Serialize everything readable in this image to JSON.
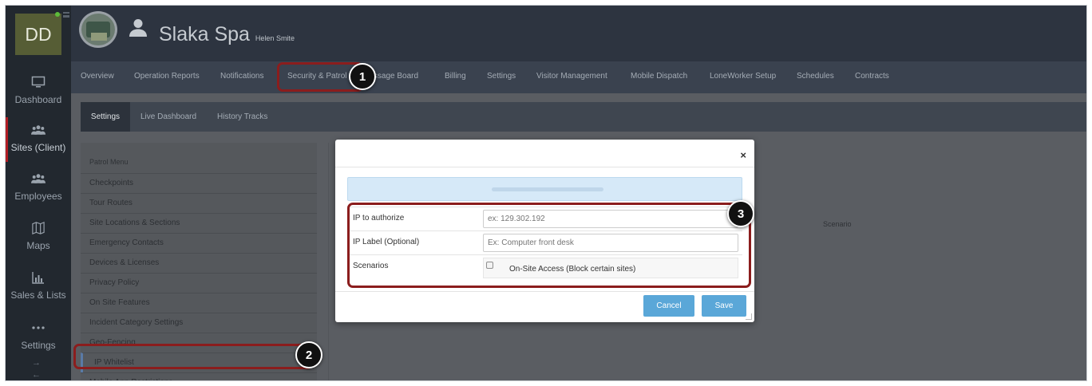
{
  "brand": {
    "initials": "DD"
  },
  "header": {
    "company": "Slaka Spa",
    "user": "Helen Smite"
  },
  "rail": {
    "items": [
      {
        "label": "Dashboard",
        "icon": "monitor-icon"
      },
      {
        "label": "Sites (Client)",
        "icon": "users-group-icon"
      },
      {
        "label": "Employees",
        "icon": "users-group-icon"
      },
      {
        "label": "Maps",
        "icon": "map-icon"
      },
      {
        "label": "Sales & Lists",
        "icon": "bar-chart-icon"
      },
      {
        "label": "Settings",
        "icon": "dots-icon"
      }
    ],
    "arrows": [
      "→",
      "←"
    ]
  },
  "nav": {
    "tabs": [
      "Overview",
      "Operation Reports",
      "Notifications",
      "Security & Patrol",
      "Message Board",
      "Billing",
      "Settings",
      "Visitor Management",
      "Mobile Dispatch",
      "LoneWorker Setup",
      "Schedules",
      "Contracts"
    ]
  },
  "subnav": {
    "tabs": [
      "Settings",
      "Live Dashboard",
      "History Tracks"
    ]
  },
  "patrol": {
    "title": "Patrol Menu",
    "items": [
      "Checkpoints",
      "Tour Routes",
      "Site Locations & Sections",
      "Emergency Contacts",
      "Devices & Licenses",
      "Privacy Policy",
      "On Site Features",
      "Incident Category Settings",
      "Geo-Fencing",
      "IP Whitelist",
      "Mobile App Restrictions"
    ]
  },
  "table": {
    "scenario_header": "Scenario"
  },
  "modal": {
    "close": "×",
    "fields": {
      "ip_label": "IP to authorize",
      "ip_placeholder": "ex: 129.302.192",
      "label_label": "IP Label (Optional)",
      "label_placeholder": "Ex: Computer front desk",
      "scenarios_label": "Scenarios",
      "scenario_option": "On-Site Access (Block certain sites)"
    },
    "buttons": {
      "cancel": "Cancel",
      "save": "Save"
    }
  },
  "callouts": [
    "1",
    "2",
    "3"
  ],
  "colors": {
    "accent": "#5aa7d8",
    "callout_border": "#8b1d1d",
    "active_rail": "#b11d24"
  }
}
